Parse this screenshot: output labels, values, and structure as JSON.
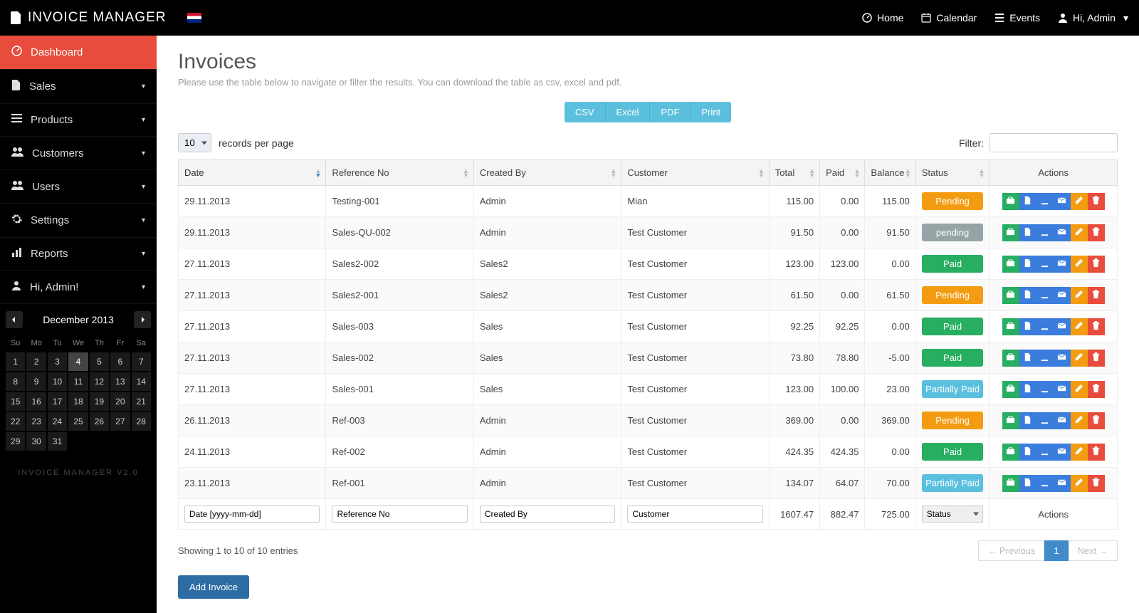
{
  "brand": "INVOICE MANAGER",
  "topnav": {
    "home": "Home",
    "calendar": "Calendar",
    "events": "Events",
    "user": "Hi, Admin"
  },
  "sidebar": {
    "items": [
      {
        "label": "Dashboard",
        "icon": "dashboard",
        "active": true
      },
      {
        "label": "Sales",
        "icon": "file"
      },
      {
        "label": "Products",
        "icon": "list"
      },
      {
        "label": "Customers",
        "icon": "users"
      },
      {
        "label": "Users",
        "icon": "users"
      },
      {
        "label": "Settings",
        "icon": "gear"
      },
      {
        "label": "Reports",
        "icon": "chart"
      },
      {
        "label": "Hi, Admin!",
        "icon": "user"
      }
    ],
    "footer": "INVOICE MANAGER V2.0"
  },
  "calendar": {
    "title": "December 2013",
    "dow": [
      "Su",
      "Mo",
      "Tu",
      "We",
      "Th",
      "Fr",
      "Sa"
    ],
    "today": 4,
    "days": [
      1,
      2,
      3,
      4,
      5,
      6,
      7,
      8,
      9,
      10,
      11,
      12,
      13,
      14,
      15,
      16,
      17,
      18,
      19,
      20,
      21,
      22,
      23,
      24,
      25,
      26,
      27,
      28,
      29,
      30,
      31
    ]
  },
  "page": {
    "title": "Invoices",
    "subtitle": "Please use the table below to navigate or filter the results. You can download the table as csv, excel and pdf."
  },
  "export": {
    "csv": "CSV",
    "excel": "Excel",
    "pdf": "PDF",
    "print": "Print"
  },
  "records": {
    "value": "10",
    "label": "records per page"
  },
  "filter": {
    "label": "Filter:",
    "value": ""
  },
  "columns": {
    "date": "Date",
    "ref": "Reference No",
    "created": "Created By",
    "customer": "Customer",
    "total": "Total",
    "paid": "Paid",
    "balance": "Balance",
    "status": "Status",
    "actions": "Actions"
  },
  "rows": [
    {
      "date": "29.11.2013",
      "ref": "Testing-001",
      "created": "Admin",
      "customer": "Mian",
      "total": "115.00",
      "paid": "0.00",
      "balance": "115.00",
      "status": "Pending",
      "statusClass": "st-pending-orange"
    },
    {
      "date": "29.11.2013",
      "ref": "Sales-QU-002",
      "created": "Admin",
      "customer": "Test Customer",
      "total": "91.50",
      "paid": "0.00",
      "balance": "91.50",
      "status": "pending",
      "statusClass": "st-pending-gray"
    },
    {
      "date": "27.11.2013",
      "ref": "Sales2-002",
      "created": "Sales2",
      "customer": "Test Customer",
      "total": "123.00",
      "paid": "123.00",
      "balance": "0.00",
      "status": "Paid",
      "statusClass": "st-paid"
    },
    {
      "date": "27.11.2013",
      "ref": "Sales2-001",
      "created": "Sales2",
      "customer": "Test Customer",
      "total": "61.50",
      "paid": "0.00",
      "balance": "61.50",
      "status": "Pending",
      "statusClass": "st-pending-orange"
    },
    {
      "date": "27.11.2013",
      "ref": "Sales-003",
      "created": "Sales",
      "customer": "Test Customer",
      "total": "92.25",
      "paid": "92.25",
      "balance": "0.00",
      "status": "Paid",
      "statusClass": "st-paid"
    },
    {
      "date": "27.11.2013",
      "ref": "Sales-002",
      "created": "Sales",
      "customer": "Test Customer",
      "total": "73.80",
      "paid": "78.80",
      "balance": "-5.00",
      "status": "Paid",
      "statusClass": "st-paid"
    },
    {
      "date": "27.11.2013",
      "ref": "Sales-001",
      "created": "Sales",
      "customer": "Test Customer",
      "total": "123.00",
      "paid": "100.00",
      "balance": "23.00",
      "status": "Partially Paid",
      "statusClass": "st-partial"
    },
    {
      "date": "26.11.2013",
      "ref": "Ref-003",
      "created": "Admin",
      "customer": "Test Customer",
      "total": "369.00",
      "paid": "0.00",
      "balance": "369.00",
      "status": "Pending",
      "statusClass": "st-pending-orange"
    },
    {
      "date": "24.11.2013",
      "ref": "Ref-002",
      "created": "Admin",
      "customer": "Test Customer",
      "total": "424.35",
      "paid": "424.35",
      "balance": "0.00",
      "status": "Paid",
      "statusClass": "st-paid"
    },
    {
      "date": "23.11.2013",
      "ref": "Ref-001",
      "created": "Admin",
      "customer": "Test Customer",
      "total": "134.07",
      "paid": "64.07",
      "balance": "70.00",
      "status": "Partially Paid",
      "statusClass": "st-partial"
    }
  ],
  "footerRow": {
    "date_ph": "Date [yyyy-mm-dd]",
    "ref_ph": "Reference No",
    "created_ph": "Created By",
    "customer_ph": "Customer",
    "total": "1607.47",
    "paid": "882.47",
    "balance": "725.00",
    "status_ph": "Status",
    "actions": "Actions"
  },
  "tableInfo": "Showing 1 to 10 of 10 entries",
  "pagination": {
    "prev": "← Previous",
    "page": "1",
    "next": "Next →"
  },
  "addButton": "Add Invoice"
}
